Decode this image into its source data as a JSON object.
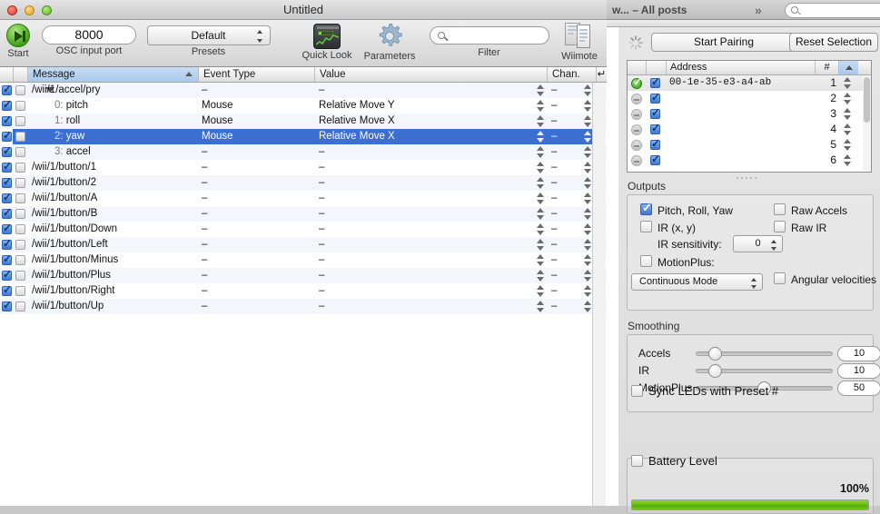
{
  "background_window": {
    "title": "w... – All posts",
    "chevrons_icon": "double-chevron-right-icon",
    "search_icon": "search-icon"
  },
  "window": {
    "title": "Untitled",
    "close_icon": "close-icon",
    "minimize_icon": "minimize-icon",
    "zoom_icon": "zoom-icon"
  },
  "toolbar": {
    "start_label": "Start",
    "start_icon": "play-button-icon",
    "port_value": "8000",
    "port_label": "OSC input port",
    "presets_value": "Default",
    "presets_label": "Presets",
    "quicklook_label": "Quick Look",
    "quicklook_icon": "quick-look-graph-icon",
    "parameters_label": "Parameters",
    "parameters_icon": "gear-icon",
    "filter_label": "Filter",
    "filter_placeholder": "",
    "filter_value": "",
    "filter_icon": "search-icon",
    "wiimote_label": "Wiimote",
    "wiimote_icon": "wiimote-panel-icon"
  },
  "table": {
    "columns": {
      "enable": "",
      "mute": "",
      "message": "Message",
      "event_type": "Event Type",
      "value": "Value",
      "channel": "Chan.",
      "return": "↵"
    },
    "sorted_column": "Message",
    "sort_direction": "ascending",
    "rows": [
      {
        "enabled": true,
        "muted": false,
        "indent": false,
        "disclosure": "expanded",
        "index": "",
        "message": "/wii/1/accel/pry",
        "event_type": "–",
        "value": "–",
        "channel": "–",
        "selected": false
      },
      {
        "enabled": true,
        "muted": false,
        "indent": true,
        "disclosure": "",
        "index": "0:",
        "message": "pitch",
        "event_type": "Mouse",
        "value": "Relative Move Y",
        "channel": "–",
        "selected": false
      },
      {
        "enabled": true,
        "muted": false,
        "indent": true,
        "disclosure": "",
        "index": "1:",
        "message": "roll",
        "event_type": "Mouse",
        "value": "Relative Move X",
        "channel": "–",
        "selected": false
      },
      {
        "enabled": true,
        "muted": false,
        "indent": true,
        "disclosure": "",
        "index": "2:",
        "message": "yaw",
        "event_type": "Mouse",
        "value": "Relative Move X",
        "channel": "–",
        "selected": true
      },
      {
        "enabled": true,
        "muted": false,
        "indent": true,
        "disclosure": "",
        "index": "3:",
        "message": "accel",
        "event_type": "–",
        "value": "–",
        "channel": "–",
        "selected": false
      },
      {
        "enabled": true,
        "muted": false,
        "indent": false,
        "disclosure": "",
        "index": "",
        "message": "/wii/1/button/1",
        "event_type": "–",
        "value": "–",
        "channel": "–",
        "selected": false
      },
      {
        "enabled": true,
        "muted": false,
        "indent": false,
        "disclosure": "",
        "index": "",
        "message": "/wii/1/button/2",
        "event_type": "–",
        "value": "–",
        "channel": "–",
        "selected": false
      },
      {
        "enabled": true,
        "muted": false,
        "indent": false,
        "disclosure": "",
        "index": "",
        "message": "/wii/1/button/A",
        "event_type": "–",
        "value": "–",
        "channel": "–",
        "selected": false
      },
      {
        "enabled": true,
        "muted": false,
        "indent": false,
        "disclosure": "",
        "index": "",
        "message": "/wii/1/button/B",
        "event_type": "–",
        "value": "–",
        "channel": "–",
        "selected": false
      },
      {
        "enabled": true,
        "muted": false,
        "indent": false,
        "disclosure": "",
        "index": "",
        "message": "/wii/1/button/Down",
        "event_type": "–",
        "value": "–",
        "channel": "–",
        "selected": false
      },
      {
        "enabled": true,
        "muted": false,
        "indent": false,
        "disclosure": "",
        "index": "",
        "message": "/wii/1/button/Left",
        "event_type": "–",
        "value": "–",
        "channel": "–",
        "selected": false
      },
      {
        "enabled": true,
        "muted": false,
        "indent": false,
        "disclosure": "",
        "index": "",
        "message": "/wii/1/button/Minus",
        "event_type": "–",
        "value": "–",
        "channel": "–",
        "selected": false
      },
      {
        "enabled": true,
        "muted": false,
        "indent": false,
        "disclosure": "",
        "index": "",
        "message": "/wii/1/button/Plus",
        "event_type": "–",
        "value": "–",
        "channel": "–",
        "selected": false
      },
      {
        "enabled": true,
        "muted": false,
        "indent": false,
        "disclosure": "",
        "index": "",
        "message": "/wii/1/button/Right",
        "event_type": "–",
        "value": "–",
        "channel": "–",
        "selected": false
      },
      {
        "enabled": true,
        "muted": false,
        "indent": false,
        "disclosure": "",
        "index": "",
        "message": "/wii/1/button/Up",
        "event_type": "–",
        "value": "–",
        "channel": "–",
        "selected": false
      }
    ]
  },
  "inspector": {
    "spinner_icon": "activity-spinner-icon",
    "start_pairing_label": "Start Pairing",
    "reset_selection_label": "Reset Selection",
    "address_table": {
      "columns": {
        "status": "",
        "enable": "",
        "address": "Address",
        "number": "#"
      },
      "sorted_column": "#",
      "rows": [
        {
          "status": "connected",
          "enabled": true,
          "address": "00-1e-35-e3-a4-ab",
          "number": "1"
        },
        {
          "status": "empty",
          "enabled": true,
          "address": "",
          "number": "2"
        },
        {
          "status": "empty",
          "enabled": true,
          "address": "",
          "number": "3"
        },
        {
          "status": "empty",
          "enabled": true,
          "address": "",
          "number": "4"
        },
        {
          "status": "empty",
          "enabled": true,
          "address": "",
          "number": "5"
        },
        {
          "status": "empty",
          "enabled": true,
          "address": "",
          "number": "6"
        }
      ]
    },
    "outputs": {
      "title": "Outputs",
      "pitch_roll_yaw": {
        "label": "Pitch, Roll, Yaw",
        "checked": true
      },
      "raw_accels": {
        "label": "Raw Accels",
        "checked": false
      },
      "ir_xy": {
        "label": "IR (x, y)",
        "checked": false
      },
      "raw_ir": {
        "label": "Raw IR",
        "checked": false
      },
      "ir_sensitivity_label": "IR sensitivity:",
      "ir_sensitivity_value": "0",
      "motionplus": {
        "label": "MotionPlus:",
        "checked": false
      },
      "mode_value": "Continuous Mode",
      "angular_velocities": {
        "label": "Angular velocities",
        "checked": false
      }
    },
    "smoothing": {
      "title": "Smoothing",
      "sliders": [
        {
          "label": "Accels",
          "value": "10",
          "percent": 10
        },
        {
          "label": "IR",
          "value": "10",
          "percent": 10
        },
        {
          "label": "MotionPlus",
          "value": "50",
          "percent": 50
        }
      ]
    },
    "sync_leds": {
      "label": "Sync LEDs with Preset #",
      "checked": false
    },
    "battery": {
      "label": "Battery Level",
      "checked": false,
      "percent_text": "100%",
      "percent": 100
    }
  },
  "colors": {
    "selection_blue": "#3c6fd4",
    "battery_green": "#6cc214",
    "sort_header_blue": "#a9c8ec"
  }
}
